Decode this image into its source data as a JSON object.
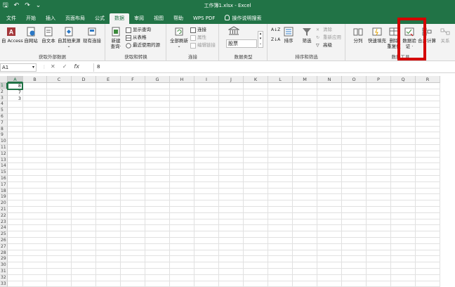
{
  "window": {
    "title": "工作簿1.xlsx  -  Excel"
  },
  "qat": {
    "save": "🖫",
    "undo": "↶",
    "redo": "↷",
    "more": "⌄"
  },
  "tabs": [
    "文件",
    "开始",
    "插入",
    "页面布局",
    "公式",
    "数据",
    "审阅",
    "视图",
    "帮助",
    "WPS PDF",
    "操作说明搜索"
  ],
  "active_tab": "数据",
  "ribbon": {
    "get_external": {
      "label": "获取外部数据",
      "buttons": [
        "自 Access",
        "自网站",
        "自文本",
        "自其他来源",
        "现有连接"
      ]
    },
    "get_transform": {
      "label": "获取和转换",
      "new_query": "新建\n查询",
      "new_query_line1": "新建",
      "new_query_line2": "查询·",
      "show_query": "显示查询",
      "from_table": "从表格",
      "recent_sources": "最近使用的源"
    },
    "connections": {
      "label": "连接",
      "refresh_all": "全部刷新",
      "connections": "连接",
      "properties": "属性",
      "edit_links": "编辑链接"
    },
    "data_types": {
      "label": "数据类型",
      "stocks": "股票"
    },
    "sort_filter": {
      "label": "排序和筛选",
      "sort": "排序",
      "filter": "筛选",
      "clear": "清除",
      "reapply": "重新应用",
      "advanced": "高级"
    },
    "data_tools": {
      "label": "数据工具",
      "text_to_columns": "分列",
      "flash_fill": "快速填充",
      "remove_dup_line1": "删除",
      "remove_dup_line2": "重复值",
      "validation_line1": "数据验",
      "validation_line2": "证 ·",
      "consolidate": "合并计算",
      "relationships": "关系"
    }
  },
  "formula_bar": {
    "name_box": "A1",
    "cancel": "✕",
    "enter": "✓",
    "fx": "fx",
    "value": "8"
  },
  "sheet": {
    "columns": [
      "A",
      "B",
      "C",
      "D",
      "E",
      "F",
      "G",
      "H",
      "I",
      "J",
      "K",
      "L",
      "M",
      "N",
      "O",
      "P",
      "Q",
      "R"
    ],
    "rows": [
      "1",
      "2",
      "3",
      "4",
      "5",
      "6",
      "7",
      "8",
      "9",
      "10",
      "11",
      "12",
      "13",
      "14",
      "15",
      "16",
      "17",
      "18",
      "19",
      "20",
      "21",
      "22",
      "23",
      "24",
      "25",
      "26",
      "27",
      "28",
      "29",
      "30",
      "31",
      "32",
      "33"
    ],
    "cells": {
      "A1": "8",
      "A2": "7",
      "A3": "3"
    }
  },
  "colors": {
    "brand": "#217346",
    "highlight": "#d40000"
  }
}
